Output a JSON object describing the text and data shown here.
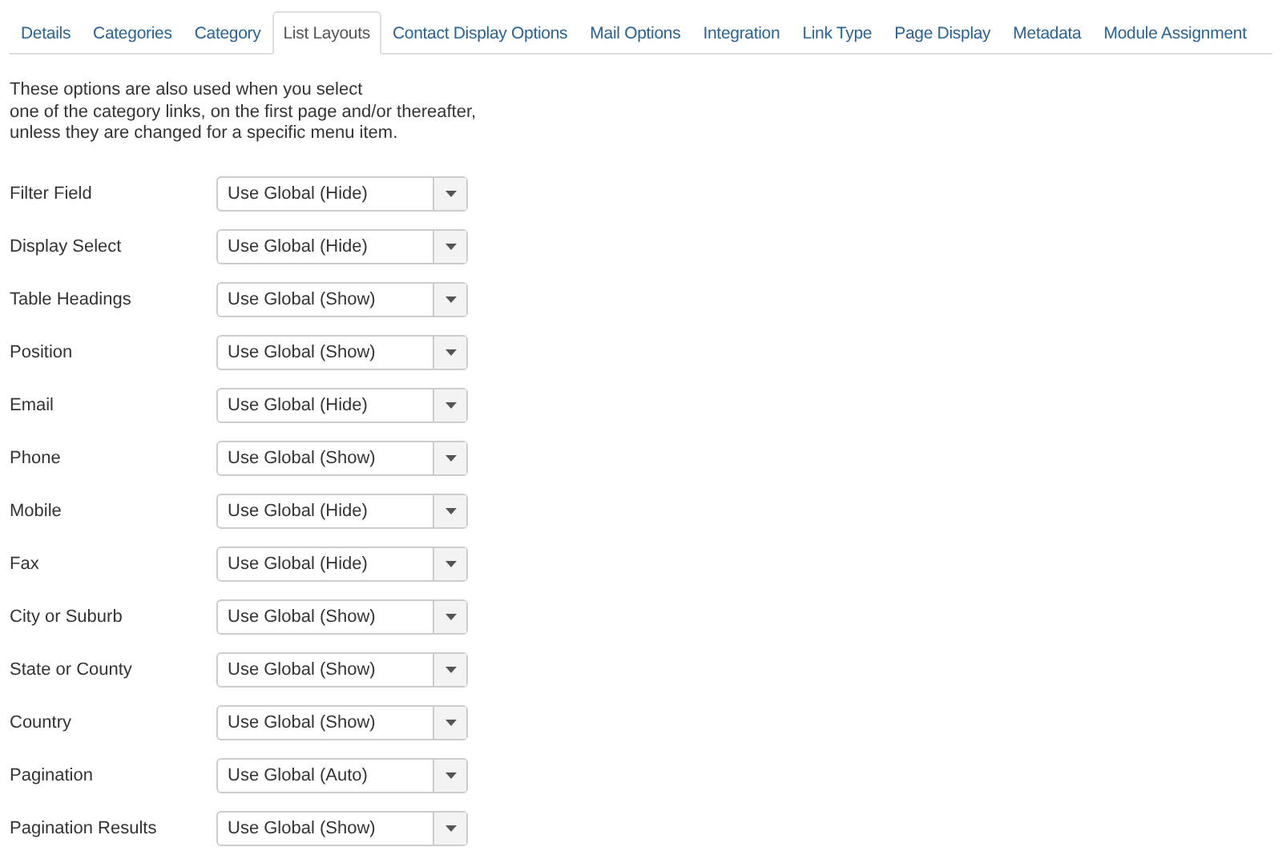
{
  "tabs": [
    {
      "label": "Details",
      "selected": false
    },
    {
      "label": "Categories",
      "selected": false
    },
    {
      "label": "Category",
      "selected": false
    },
    {
      "label": "List Layouts",
      "selected": true
    },
    {
      "label": "Contact Display Options",
      "selected": false
    },
    {
      "label": "Mail Options",
      "selected": false
    },
    {
      "label": "Integration",
      "selected": false
    },
    {
      "label": "Link Type",
      "selected": false
    },
    {
      "label": "Page Display",
      "selected": false
    },
    {
      "label": "Metadata",
      "selected": false
    },
    {
      "label": "Module Assignment",
      "selected": false
    }
  ],
  "description": [
    "These options are also used when you select",
    "one of the category links, on the first page and/or thereafter,",
    "unless they are changed for a specific menu item."
  ],
  "fields": [
    {
      "label": "Filter Field",
      "value": "Use Global (Hide)"
    },
    {
      "label": "Display Select",
      "value": "Use Global (Hide)"
    },
    {
      "label": "Table Headings",
      "value": "Use Global (Show)"
    },
    {
      "label": "Position",
      "value": "Use Global (Show)"
    },
    {
      "label": "Email",
      "value": "Use Global (Hide)"
    },
    {
      "label": "Phone",
      "value": "Use Global (Show)"
    },
    {
      "label": "Mobile",
      "value": "Use Global (Hide)"
    },
    {
      "label": "Fax",
      "value": "Use Global (Hide)"
    },
    {
      "label": "City or Suburb",
      "value": "Use Global (Show)"
    },
    {
      "label": "State or County",
      "value": "Use Global (Show)"
    },
    {
      "label": "Country",
      "value": "Use Global (Show)"
    },
    {
      "label": "Pagination",
      "value": "Use Global (Auto)"
    },
    {
      "label": "Pagination Results",
      "value": "Use Global (Show)"
    }
  ]
}
